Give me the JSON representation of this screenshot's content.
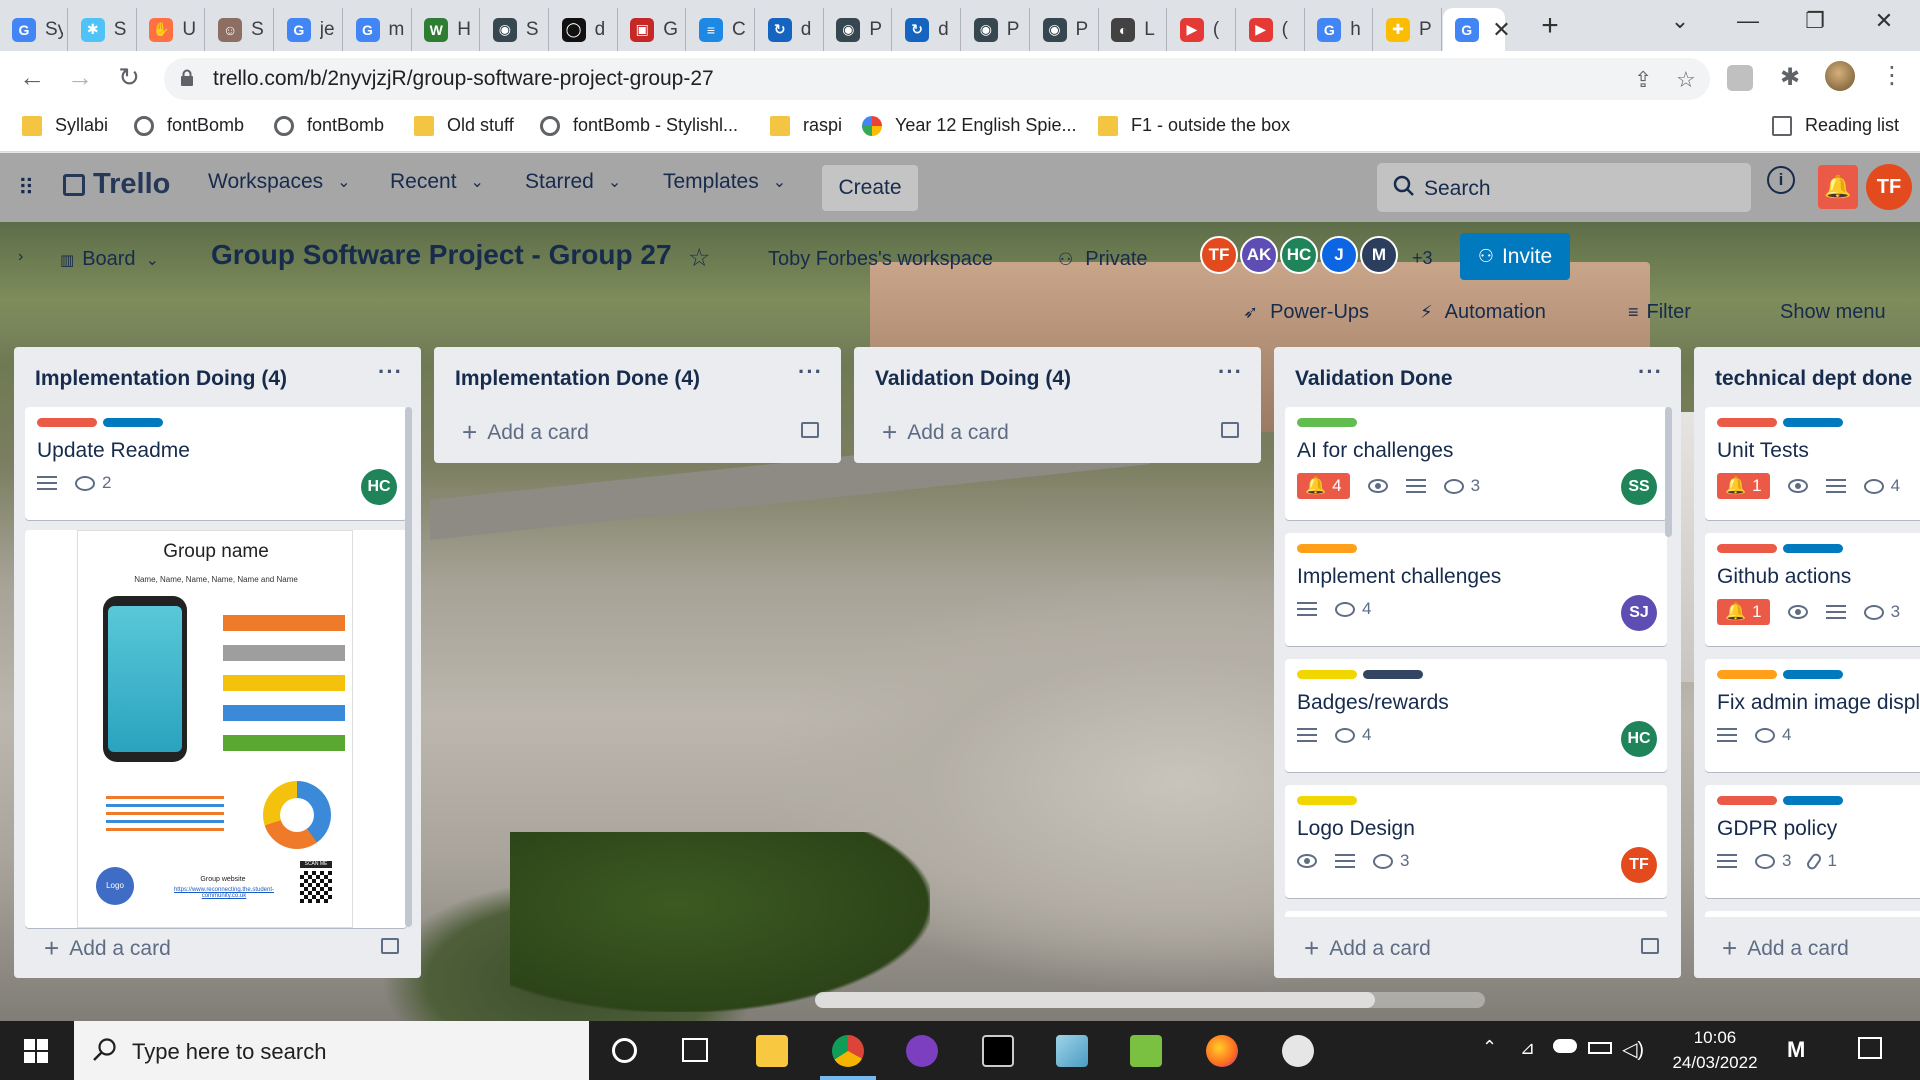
{
  "browser": {
    "tabs": [
      {
        "label": "G",
        "text": "Sy",
        "color": "#4285f4"
      },
      {
        "label": "✱",
        "text": "S",
        "color": "#4fc3f7"
      },
      {
        "label": "✋",
        "text": "U",
        "color": "#ff7043"
      },
      {
        "label": "☺",
        "text": "S",
        "color": "#8d6e63"
      },
      {
        "label": "G",
        "text": "je",
        "color": "#4285f4"
      },
      {
        "label": "G",
        "text": "m",
        "color": "#4285f4"
      },
      {
        "label": "W",
        "text": "H",
        "color": "#2e7d32"
      },
      {
        "label": "◉",
        "text": "S",
        "color": "#37474f"
      },
      {
        "label": "◯",
        "text": "d",
        "color": "#111111"
      },
      {
        "label": "▣",
        "text": "G",
        "color": "#c62828"
      },
      {
        "label": "≡",
        "text": "C",
        "color": "#1e88e5"
      },
      {
        "label": "↻",
        "text": "d",
        "color": "#1565c0"
      },
      {
        "label": "◉",
        "text": "P",
        "color": "#37474f"
      },
      {
        "label": "↻",
        "text": "d",
        "color": "#1565c0"
      },
      {
        "label": "◉",
        "text": "P",
        "color": "#37474f"
      },
      {
        "label": "◉",
        "text": "P",
        "color": "#37474f"
      },
      {
        "label": "◐",
        "text": "L",
        "color": "#424242"
      },
      {
        "label": "▶",
        "text": "(",
        "color": "#e53935"
      },
      {
        "label": "▶",
        "text": "(",
        "color": "#e53935"
      },
      {
        "label": "G",
        "text": "h",
        "color": "#4285f4"
      },
      {
        "label": "✚",
        "text": "P",
        "color": "#fbbc04"
      },
      {
        "label": "G",
        "text": "",
        "color": "#4285f4"
      }
    ],
    "url": "trello.com/b/2nyvjzjR/group-software-project-group-27",
    "bookmarks": [
      {
        "label": "Syllabi",
        "icon": "folder"
      },
      {
        "label": "fontBomb",
        "icon": "globe"
      },
      {
        "label": "fontBomb",
        "icon": "globe"
      },
      {
        "label": "Old stuff",
        "icon": "folder"
      },
      {
        "label": "fontBomb - Stylishl...",
        "icon": "globe"
      },
      {
        "label": "raspi",
        "icon": "folder"
      },
      {
        "label": "Year 12 English Spie...",
        "icon": "pinwheel"
      },
      {
        "label": "F1 - outside the box",
        "icon": "folder"
      }
    ],
    "reading_list": "Reading list"
  },
  "trello": {
    "logo": "Trello",
    "nav": [
      "Workspaces",
      "Recent",
      "Starred",
      "Templates"
    ],
    "create": "Create",
    "search_placeholder": "Search",
    "user_initials": "TF"
  },
  "board": {
    "view": "Board",
    "title": "Group Software Project - Group 27",
    "workspace": "Toby Forbes's workspace",
    "visibility": "Private",
    "members": [
      {
        "initials": "TF",
        "color": "#e34b1e"
      },
      {
        "initials": "AK",
        "color": "#5e4db2"
      },
      {
        "initials": "HC",
        "color": "#1f845a"
      },
      {
        "initials": "J",
        "color": "#0c66e4"
      },
      {
        "initials": "M",
        "color": "#2c3e5d"
      }
    ],
    "more_members": "+3",
    "invite": "Invite",
    "powerups": "Power-Ups",
    "automation": "Automation",
    "filter": "Filter",
    "show_menu": "Show menu",
    "add_card": "Add a card",
    "lists": [
      {
        "title": "Implementation Doing (4)",
        "cards": [
          {
            "title": "Update Readme",
            "labels": [
              "#eb5a46",
              "#0079bf"
            ],
            "comments": "2",
            "member": "HC",
            "member_color": "#1f845a"
          }
        ],
        "poster": {
          "heading": "Group name",
          "names": "Name, Name, Name, Name, Name and Name",
          "logo": "Logo",
          "website": "Group website",
          "link": "https://www.reconnecting.the.student-community.co.uk",
          "scan": "SCAN ME"
        }
      },
      {
        "title": "Implementation Done (4)",
        "cards": []
      },
      {
        "title": "Validation Doing (4)",
        "cards": []
      },
      {
        "title": "Validation Done",
        "cards": [
          {
            "title": "AI for challenges",
            "labels": [
              "#61bd4f"
            ],
            "notif": "4",
            "watch": true,
            "comments": "3",
            "member": "SS",
            "member_color": "#1f845a"
          },
          {
            "title": "Implement challenges",
            "labels": [
              "#ff9f1a"
            ],
            "comments": "4",
            "member": "SJ",
            "member_color": "#5e4db2"
          },
          {
            "title": "Badges/rewards",
            "labels": [
              "#f2d600",
              "#344563"
            ],
            "comments": "4",
            "member": "HC",
            "member_color": "#1f845a"
          },
          {
            "title": "Logo Design",
            "labels": [
              "#f2d600"
            ],
            "watch": true,
            "comments": "3",
            "member": "TF",
            "member_color": "#e34b1e"
          }
        ]
      },
      {
        "title": "technical dept done",
        "cards": [
          {
            "title": "Unit Tests",
            "labels": [
              "#eb5a46",
              "#0079bf"
            ],
            "notif": "1",
            "watch": true,
            "comments": "4"
          },
          {
            "title": "Github actions",
            "labels": [
              "#eb5a46",
              "#0079bf"
            ],
            "notif": "1",
            "watch": true,
            "comments": "3"
          },
          {
            "title": "Fix admin image displ",
            "labels": [
              "#ff9f1a",
              "#0079bf"
            ],
            "comments": "4"
          },
          {
            "title": "GDPR policy",
            "labels": [
              "#eb5a46",
              "#0079bf"
            ],
            "comments": "3",
            "attachments": "1"
          }
        ]
      }
    ]
  },
  "taskbar": {
    "search_placeholder": "Type here to search",
    "time": "10:06",
    "date": "24/03/2022"
  }
}
